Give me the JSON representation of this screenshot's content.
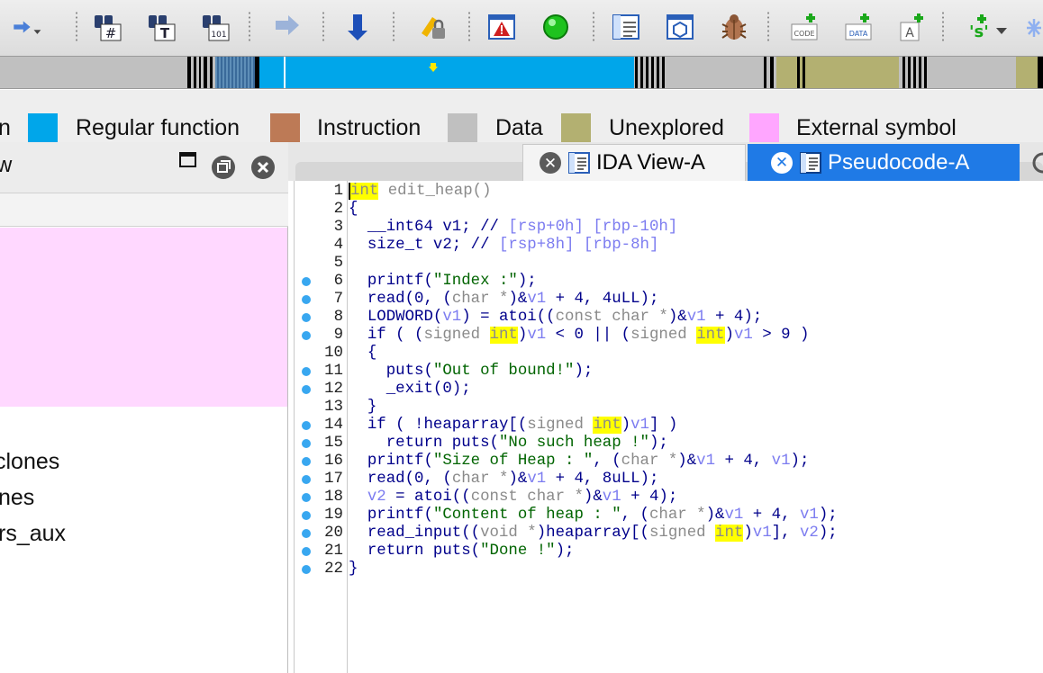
{
  "toolbar": {
    "buttons": [
      {
        "icon": "forward-arrow-dropdown-icon"
      },
      {
        "icon": "binoculars-hash-icon"
      },
      {
        "icon": "binoculars-text-icon"
      },
      {
        "icon": "binoculars-binary-icon"
      },
      {
        "icon": "jump-arrow-icon"
      },
      {
        "icon": "step-down-arrow-icon"
      },
      {
        "icon": "lock-pen-icon"
      },
      {
        "icon": "warning-window-icon"
      },
      {
        "icon": "green-circle-icon"
      },
      {
        "icon": "disassembly-window-icon"
      },
      {
        "icon": "structure-window-icon"
      },
      {
        "icon": "bug-icon"
      },
      {
        "icon": "add-code-icon"
      },
      {
        "icon": "add-data-icon"
      },
      {
        "icon": "add-ascii-icon"
      },
      {
        "icon": "add-string-dropdown-icon"
      },
      {
        "icon": "sparkle-icon"
      }
    ]
  },
  "legend": {
    "items": [
      {
        "label": "n",
        "color": "#000000"
      },
      {
        "label": "Regular function",
        "color": "#00a6ea"
      },
      {
        "label": "Instruction",
        "color": "#bd7a56"
      },
      {
        "label": "Data",
        "color": "#c0c0c0"
      },
      {
        "label": "Unexplored",
        "color": "#b3b071"
      },
      {
        "label": "External symbol",
        "color": "#ffa6ff"
      }
    ]
  },
  "left_panel": {
    "title": "w",
    "items": [
      "clones",
      "nes",
      "rs_aux"
    ]
  },
  "tabs": [
    {
      "label": "IDA View-A",
      "active": false
    },
    {
      "label": "Pseudocode-A",
      "active": true
    }
  ],
  "code": {
    "lines": [
      {
        "n": "1",
        "dot": false,
        "tokens": [
          [
            "hlc",
            "int"
          ],
          [
            "cast",
            " edit_heap()"
          ]
        ]
      },
      {
        "n": "2",
        "dot": false,
        "tokens": [
          [
            "plain",
            "{"
          ]
        ]
      },
      {
        "n": "3",
        "dot": false,
        "tokens": [
          [
            "plain",
            "  __int64 v1; // "
          ],
          [
            "cmt",
            "[rsp+0h] [rbp-10h]"
          ]
        ]
      },
      {
        "n": "4",
        "dot": false,
        "tokens": [
          [
            "plain",
            "  size_t v2; // "
          ],
          [
            "cmt",
            "[rsp+8h] [rbp-8h]"
          ]
        ]
      },
      {
        "n": "5",
        "dot": false,
        "tokens": [
          [
            "plain",
            ""
          ]
        ]
      },
      {
        "n": "6",
        "dot": true,
        "tokens": [
          [
            "plain",
            "  printf("
          ],
          [
            "str",
            "\"Index :\""
          ],
          [
            "plain",
            ");"
          ]
        ]
      },
      {
        "n": "7",
        "dot": true,
        "tokens": [
          [
            "plain",
            "  read(0, ("
          ],
          [
            "cast",
            "char *"
          ],
          [
            "plain",
            ")&"
          ],
          [
            "var",
            "v1"
          ],
          [
            "plain",
            " + 4, 4uLL);"
          ]
        ]
      },
      {
        "n": "8",
        "dot": true,
        "tokens": [
          [
            "plain",
            "  LODWORD("
          ],
          [
            "var",
            "v1"
          ],
          [
            "plain",
            ") = atoi(("
          ],
          [
            "cast",
            "const char *"
          ],
          [
            "plain",
            ")&"
          ],
          [
            "var",
            "v1"
          ],
          [
            "plain",
            " + 4);"
          ]
        ]
      },
      {
        "n": "9",
        "dot": true,
        "tokens": [
          [
            "plain",
            "  if ( ("
          ],
          [
            "cast",
            "signed "
          ],
          [
            "hl",
            "int"
          ],
          [
            "plain",
            ")"
          ],
          [
            "var",
            "v1"
          ],
          [
            "plain",
            " < 0 || ("
          ],
          [
            "cast",
            "signed "
          ],
          [
            "hl",
            "int"
          ],
          [
            "plain",
            ")"
          ],
          [
            "var",
            "v1"
          ],
          [
            "plain",
            " > 9 )"
          ]
        ]
      },
      {
        "n": "10",
        "dot": false,
        "tokens": [
          [
            "plain",
            "  {"
          ]
        ]
      },
      {
        "n": "11",
        "dot": true,
        "tokens": [
          [
            "plain",
            "    puts("
          ],
          [
            "str",
            "\"Out of bound!\""
          ],
          [
            "plain",
            ");"
          ]
        ]
      },
      {
        "n": "12",
        "dot": true,
        "tokens": [
          [
            "plain",
            "    _exit(0);"
          ]
        ]
      },
      {
        "n": "13",
        "dot": false,
        "tokens": [
          [
            "plain",
            "  }"
          ]
        ]
      },
      {
        "n": "14",
        "dot": true,
        "tokens": [
          [
            "plain",
            "  if ( !heaparray[("
          ],
          [
            "cast",
            "signed "
          ],
          [
            "hl",
            "int"
          ],
          [
            "plain",
            ")"
          ],
          [
            "var",
            "v1"
          ],
          [
            "plain",
            "] )"
          ]
        ]
      },
      {
        "n": "15",
        "dot": true,
        "tokens": [
          [
            "plain",
            "    return puts("
          ],
          [
            "str",
            "\"No such heap !\""
          ],
          [
            "plain",
            ");"
          ]
        ]
      },
      {
        "n": "16",
        "dot": true,
        "tokens": [
          [
            "plain",
            "  printf("
          ],
          [
            "str",
            "\"Size of Heap : \""
          ],
          [
            "plain",
            ", ("
          ],
          [
            "cast",
            "char *"
          ],
          [
            "plain",
            ")&"
          ],
          [
            "var",
            "v1"
          ],
          [
            "plain",
            " + 4, "
          ],
          [
            "var",
            "v1"
          ],
          [
            "plain",
            ");"
          ]
        ]
      },
      {
        "n": "17",
        "dot": true,
        "tokens": [
          [
            "plain",
            "  read(0, ("
          ],
          [
            "cast",
            "char *"
          ],
          [
            "plain",
            ")&"
          ],
          [
            "var",
            "v1"
          ],
          [
            "plain",
            " + 4, 8uLL);"
          ]
        ]
      },
      {
        "n": "18",
        "dot": true,
        "tokens": [
          [
            "var",
            "  v2"
          ],
          [
            "plain",
            " = atoi(("
          ],
          [
            "cast",
            "const char *"
          ],
          [
            "plain",
            ")&"
          ],
          [
            "var",
            "v1"
          ],
          [
            "plain",
            " + 4);"
          ]
        ]
      },
      {
        "n": "19",
        "dot": true,
        "tokens": [
          [
            "plain",
            "  printf("
          ],
          [
            "str",
            "\"Content of heap : \""
          ],
          [
            "plain",
            ", ("
          ],
          [
            "cast",
            "char *"
          ],
          [
            "plain",
            ")&"
          ],
          [
            "var",
            "v1"
          ],
          [
            "plain",
            " + 4, "
          ],
          [
            "var",
            "v1"
          ],
          [
            "plain",
            ");"
          ]
        ]
      },
      {
        "n": "20",
        "dot": true,
        "tokens": [
          [
            "plain",
            "  read_input(("
          ],
          [
            "cast",
            "void *"
          ],
          [
            "plain",
            ")heaparray[("
          ],
          [
            "cast",
            "signed "
          ],
          [
            "hl",
            "int"
          ],
          [
            "plain",
            ")"
          ],
          [
            "var",
            "v1"
          ],
          [
            "plain",
            "], "
          ],
          [
            "var",
            "v2"
          ],
          [
            "plain",
            ");"
          ]
        ]
      },
      {
        "n": "21",
        "dot": true,
        "tokens": [
          [
            "plain",
            "  return puts("
          ],
          [
            "str",
            "\"Done !\""
          ],
          [
            "plain",
            ");"
          ]
        ]
      },
      {
        "n": "22",
        "dot": true,
        "tokens": [
          [
            "plain",
            "}"
          ]
        ]
      }
    ]
  },
  "colors": {
    "regular_function": "#00a6ea",
    "instruction": "#bd7a56",
    "data": "#c0c0c0",
    "unexplored": "#b3b071",
    "external_symbol": "#ffa6ff",
    "tab_active": "#1f7ae6",
    "highlight": "#ffff00"
  }
}
